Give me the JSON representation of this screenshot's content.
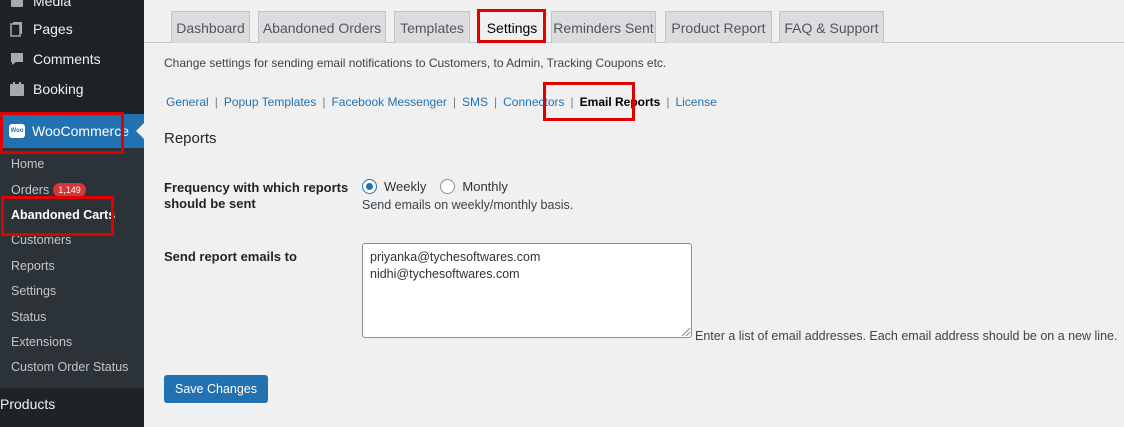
{
  "sidebar": {
    "items": [
      {
        "label": "Media",
        "icon": "media-icon"
      },
      {
        "label": "Pages",
        "icon": "pages-icon"
      },
      {
        "label": "Comments",
        "icon": "comments-icon"
      },
      {
        "label": "Booking",
        "icon": "calendar-icon"
      }
    ],
    "woocommerce": {
      "label": "WooCommerce",
      "logo": "Woo"
    },
    "submenu": [
      {
        "label": "Home"
      },
      {
        "label": "Orders",
        "badge": "1,149"
      },
      {
        "label": "Abandoned Carts"
      },
      {
        "label": "Customers"
      },
      {
        "label": "Reports"
      },
      {
        "label": "Settings"
      },
      {
        "label": "Status"
      },
      {
        "label": "Extensions"
      },
      {
        "label": "Custom Order Status"
      }
    ],
    "products": {
      "label": "Products",
      "icon": "archive-icon"
    }
  },
  "tabs": [
    {
      "label": "Dashboard"
    },
    {
      "label": "Abandoned Orders"
    },
    {
      "label": "Templates"
    },
    {
      "label": "Settings"
    },
    {
      "label": "Reminders Sent"
    },
    {
      "label": "Product Report"
    },
    {
      "label": "FAQ & Support"
    }
  ],
  "description": "Change settings for sending email notifications to Customers, to Admin, Tracking Coupons etc.",
  "subnav": [
    {
      "label": "General"
    },
    {
      "label": "Popup Templates"
    },
    {
      "label": "Facebook Messenger"
    },
    {
      "label": "SMS"
    },
    {
      "label": "Connectors"
    },
    {
      "label": "Email Reports"
    },
    {
      "label": "License"
    }
  ],
  "section_title": "Reports",
  "frequency": {
    "label_line1": "Frequency with which reports",
    "label_line2": "should be sent",
    "options": [
      {
        "label": "Weekly",
        "checked": true
      },
      {
        "label": "Monthly",
        "checked": false
      }
    ],
    "help": "Send emails on weekly/monthly basis."
  },
  "recipients": {
    "label": "Send report emails to",
    "emails": [
      "priyanka@tychesoftwares.com",
      "nidhi@tychesoftwares.com"
    ],
    "help": "Enter a list of email addresses. Each email address should be on a new line."
  },
  "save_label": "Save Changes",
  "colors": {
    "accent": "#2271b1",
    "highlight": "#e00000",
    "sidebar": "#1d2327",
    "badge": "#d63638"
  }
}
